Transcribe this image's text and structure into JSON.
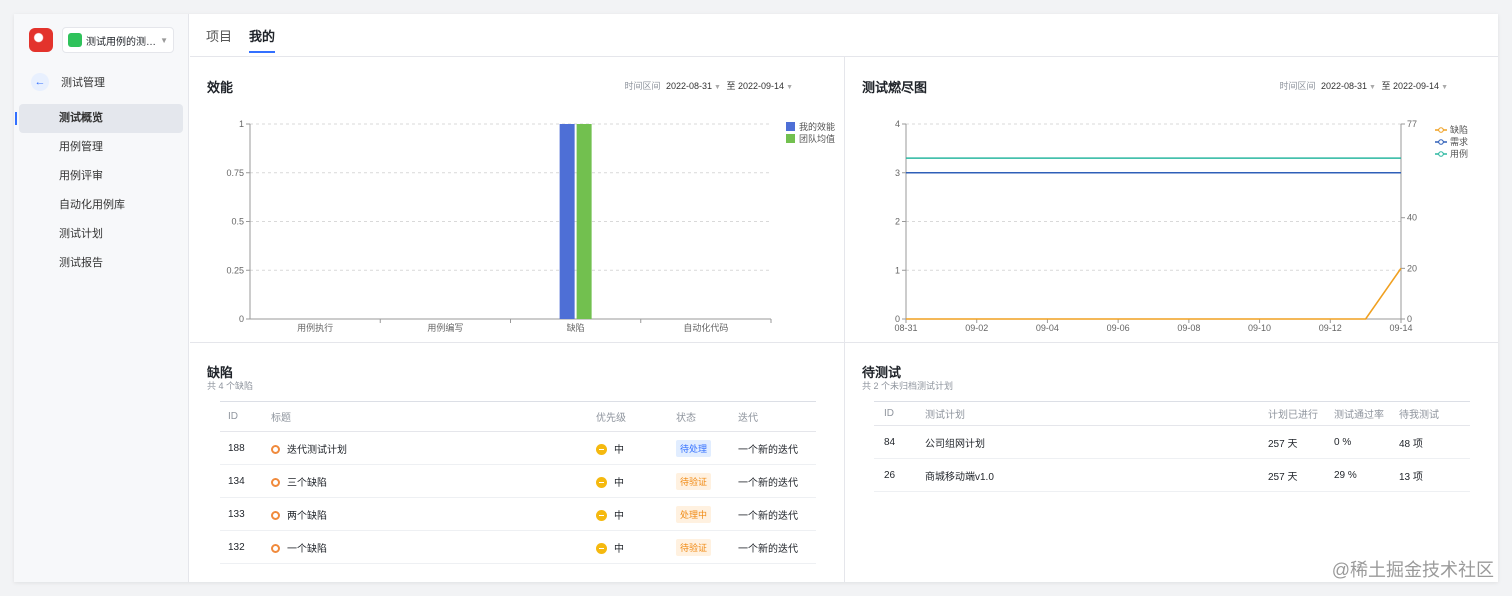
{
  "project": {
    "name": "测试用例的测试项目"
  },
  "sidebar": {
    "back_label": "测试管理",
    "items": [
      {
        "label": "测试概览",
        "active": true
      },
      {
        "label": "用例管理"
      },
      {
        "label": "用例评审"
      },
      {
        "label": "自动化用例库"
      },
      {
        "label": "测试计划"
      },
      {
        "label": "测试报告"
      }
    ]
  },
  "tabs": [
    {
      "label": "项目"
    },
    {
      "label": "我的",
      "active": true
    }
  ],
  "efficiency": {
    "title": "效能",
    "range_label": "时间区间",
    "start": "2022-08-31",
    "sep": "至",
    "end": "2022-09-14"
  },
  "burndown": {
    "title": "测试燃尽图",
    "range_label": "时间区间",
    "start": "2022-08-31",
    "sep": "至",
    "end": "2022-09-14"
  },
  "defects": {
    "title": "缺陷",
    "subtitle": "共 4 个缺陷",
    "columns": [
      "ID",
      "标题",
      "优先级",
      "状态",
      "迭代"
    ],
    "rows": [
      {
        "id": "188",
        "title": "迭代测试计划",
        "priority": "中",
        "status": "待处理",
        "status_color": "blue",
        "iteration": "一个新的迭代"
      },
      {
        "id": "134",
        "title": "三个缺陷",
        "priority": "中",
        "status": "待验证",
        "status_color": "orange",
        "iteration": "一个新的迭代"
      },
      {
        "id": "133",
        "title": "两个缺陷",
        "priority": "中",
        "status": "处理中",
        "status_color": "orange",
        "iteration": "一个新的迭代"
      },
      {
        "id": "132",
        "title": "一个缺陷",
        "priority": "中",
        "status": "待验证",
        "status_color": "orange",
        "iteration": "一个新的迭代"
      }
    ]
  },
  "pending": {
    "title": "待测试",
    "subtitle": "共 2 个未归档测试计划",
    "columns": [
      "ID",
      "测试计划",
      "计划已进行",
      "测试通过率",
      "待我测试"
    ],
    "rows": [
      {
        "id": "84",
        "plan": "公司组网计划",
        "elapsed": "257 天",
        "pass_rate": "0 %",
        "mine": "48 项"
      },
      {
        "id": "26",
        "plan": "商城移动端v1.0",
        "elapsed": "257 天",
        "pass_rate": "29 %",
        "mine": "13 项"
      }
    ]
  },
  "watermark": "@稀土掘金技术社区",
  "colors": {
    "blue": "#4e6fd6",
    "green": "#72c04f",
    "orange": "#f0a020",
    "teal": "#2ab7a0",
    "accent": "#3370ff"
  },
  "chart_data": [
    {
      "type": "bar",
      "categories": [
        "用例执行",
        "用例编写",
        "缺陷",
        "自动化代码"
      ],
      "series": [
        {
          "name": "我的效能",
          "values": [
            0,
            0,
            1,
            0
          ]
        },
        {
          "name": "团队均值",
          "values": [
            0,
            0,
            1,
            0
          ]
        }
      ],
      "ylim": [
        0,
        1
      ],
      "yticks": [
        "0",
        "0.25",
        "0.5",
        "0.75",
        "1"
      ],
      "grid": true,
      "legend": "top-right"
    },
    {
      "type": "line",
      "x": [
        "08-31",
        "09-01",
        "09-02",
        "09-03",
        "09-04",
        "09-05",
        "09-06",
        "09-07",
        "09-08",
        "09-09",
        "09-10",
        "09-11",
        "09-12",
        "09-13",
        "09-14"
      ],
      "xticks": [
        "08-31",
        "09-02",
        "09-04",
        "09-06",
        "09-08",
        "09-10",
        "09-12",
        "09-14"
      ],
      "series": [
        {
          "name": "缺陷",
          "axis": "right",
          "values": [
            0,
            0,
            0,
            0,
            0,
            0,
            0,
            0,
            0,
            0,
            0,
            0,
            0,
            0,
            20
          ]
        },
        {
          "name": "需求",
          "axis": "left",
          "values": [
            3,
            3,
            3,
            3,
            3,
            3,
            3,
            3,
            3,
            3,
            3,
            3,
            3,
            3,
            3
          ]
        },
        {
          "name": "用例",
          "axis": "left",
          "values": [
            3.3,
            3.3,
            3.3,
            3.3,
            3.3,
            3.3,
            3.3,
            3.3,
            3.3,
            3.3,
            3.3,
            3.3,
            3.3,
            3.3,
            3.3
          ]
        }
      ],
      "ylim_left": [
        0,
        4
      ],
      "yticks_left": [
        "0",
        "1",
        "2",
        "3",
        "4"
      ],
      "ylim_right": [
        0,
        77
      ],
      "yticks_right": [
        "0",
        "20",
        "40",
        "77"
      ],
      "grid": true,
      "legend": "top-right"
    }
  ]
}
